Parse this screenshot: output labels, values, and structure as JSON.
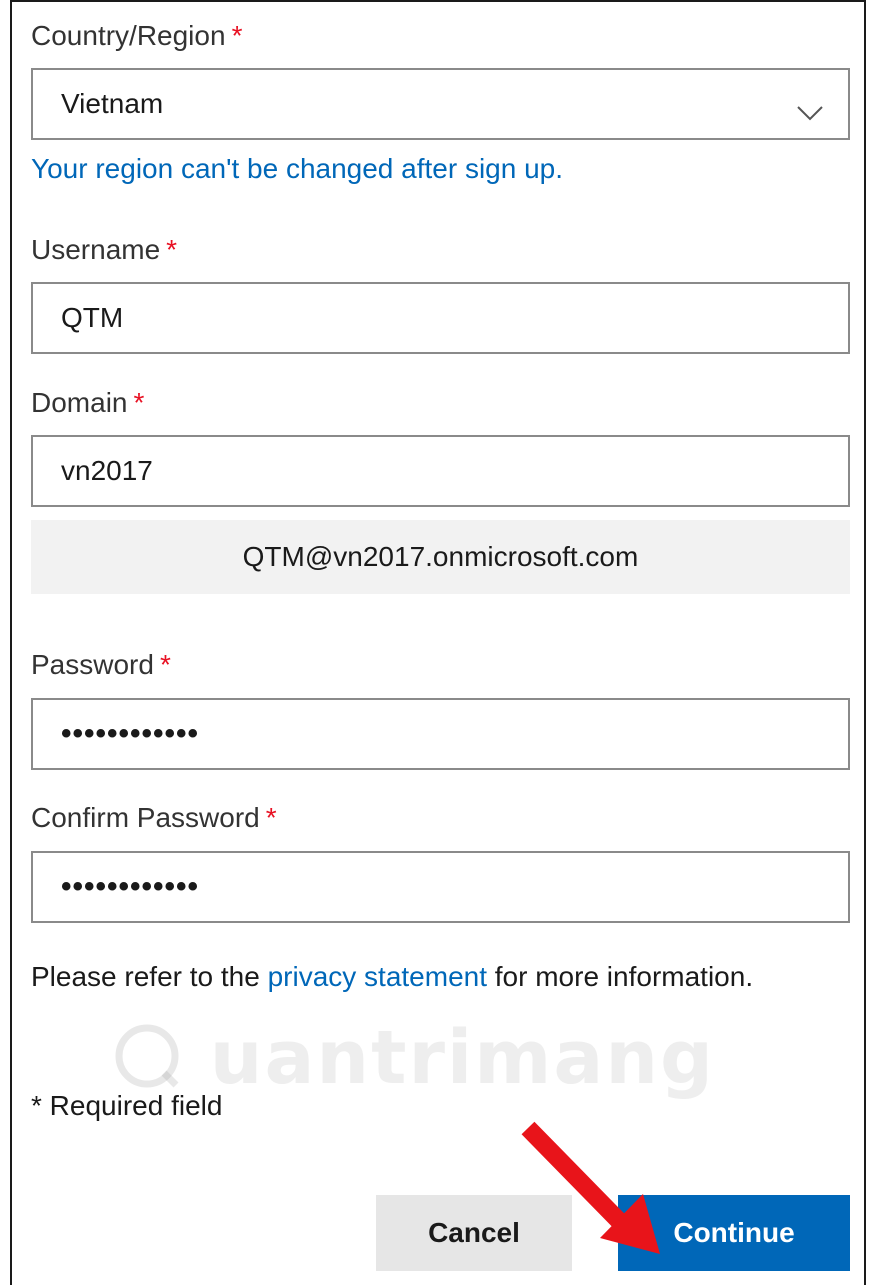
{
  "country": {
    "label": "Country/Region",
    "required_mark": "*",
    "value": "Vietnam",
    "hint": "Your region can't be changed after sign up."
  },
  "username": {
    "label": "Username",
    "required_mark": "*",
    "value": "QTM"
  },
  "domain": {
    "label": "Domain",
    "required_mark": "*",
    "value": "vn2017"
  },
  "email_preview": "QTM@vn2017.onmicrosoft.com",
  "password": {
    "label": "Password",
    "required_mark": "*",
    "masked_value": "••••••••••••"
  },
  "confirm_password": {
    "label": "Confirm Password",
    "required_mark": "*",
    "masked_value": "••••••••••••"
  },
  "privacy": {
    "before": "Please refer to the ",
    "link": "privacy statement",
    "after": " for more information."
  },
  "required_note": "* Required field",
  "buttons": {
    "cancel": "Cancel",
    "continue": "Continue"
  },
  "watermark": "uantrimang",
  "colors": {
    "link": "#0067b8",
    "required": "#e81123",
    "primary_button": "#0067b8",
    "arrow": "#e8141a"
  },
  "icons": {
    "dropdown": "chevron-down-icon",
    "annotation": "red-arrow-icon"
  }
}
